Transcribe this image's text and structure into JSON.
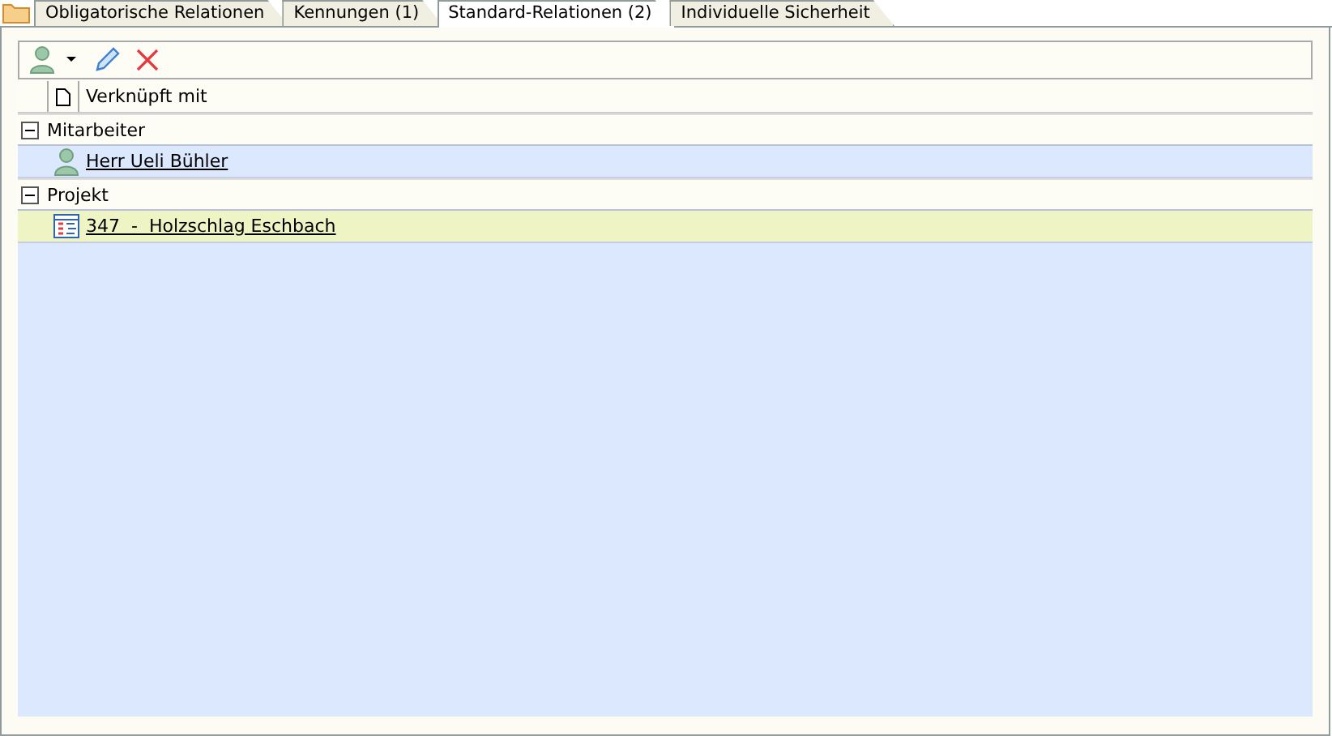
{
  "tabs": [
    {
      "label": "Obligatorische Relationen",
      "selected": false
    },
    {
      "label": "Kennungen (1)",
      "selected": false
    },
    {
      "label": "Standard-Relationen (2)",
      "selected": true
    },
    {
      "label": "Individuelle Sicherheit",
      "selected": false
    }
  ],
  "table": {
    "columns": [
      "Verknüpft mit"
    ],
    "groups": [
      {
        "label": "Mitarbeiter",
        "expanded": true,
        "rows": [
          {
            "kind": "person",
            "text": "Herr Ueli Bühler",
            "selected": false
          }
        ]
      },
      {
        "label": "Projekt",
        "expanded": true,
        "rows": [
          {
            "kind": "project",
            "text": "347  -  Holzschlag Eschbach",
            "selected": true
          }
        ]
      }
    ]
  }
}
